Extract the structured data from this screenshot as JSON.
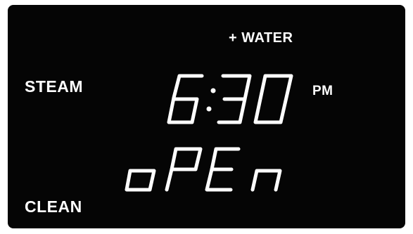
{
  "display": {
    "steam_label": "STEAM",
    "clean_label": "CLEAN",
    "water_label": "+ WATER",
    "time": "6:30",
    "period": "PM",
    "status": "oPEn"
  },
  "colors": {
    "background": "#050505",
    "segment": "#ffffff"
  }
}
